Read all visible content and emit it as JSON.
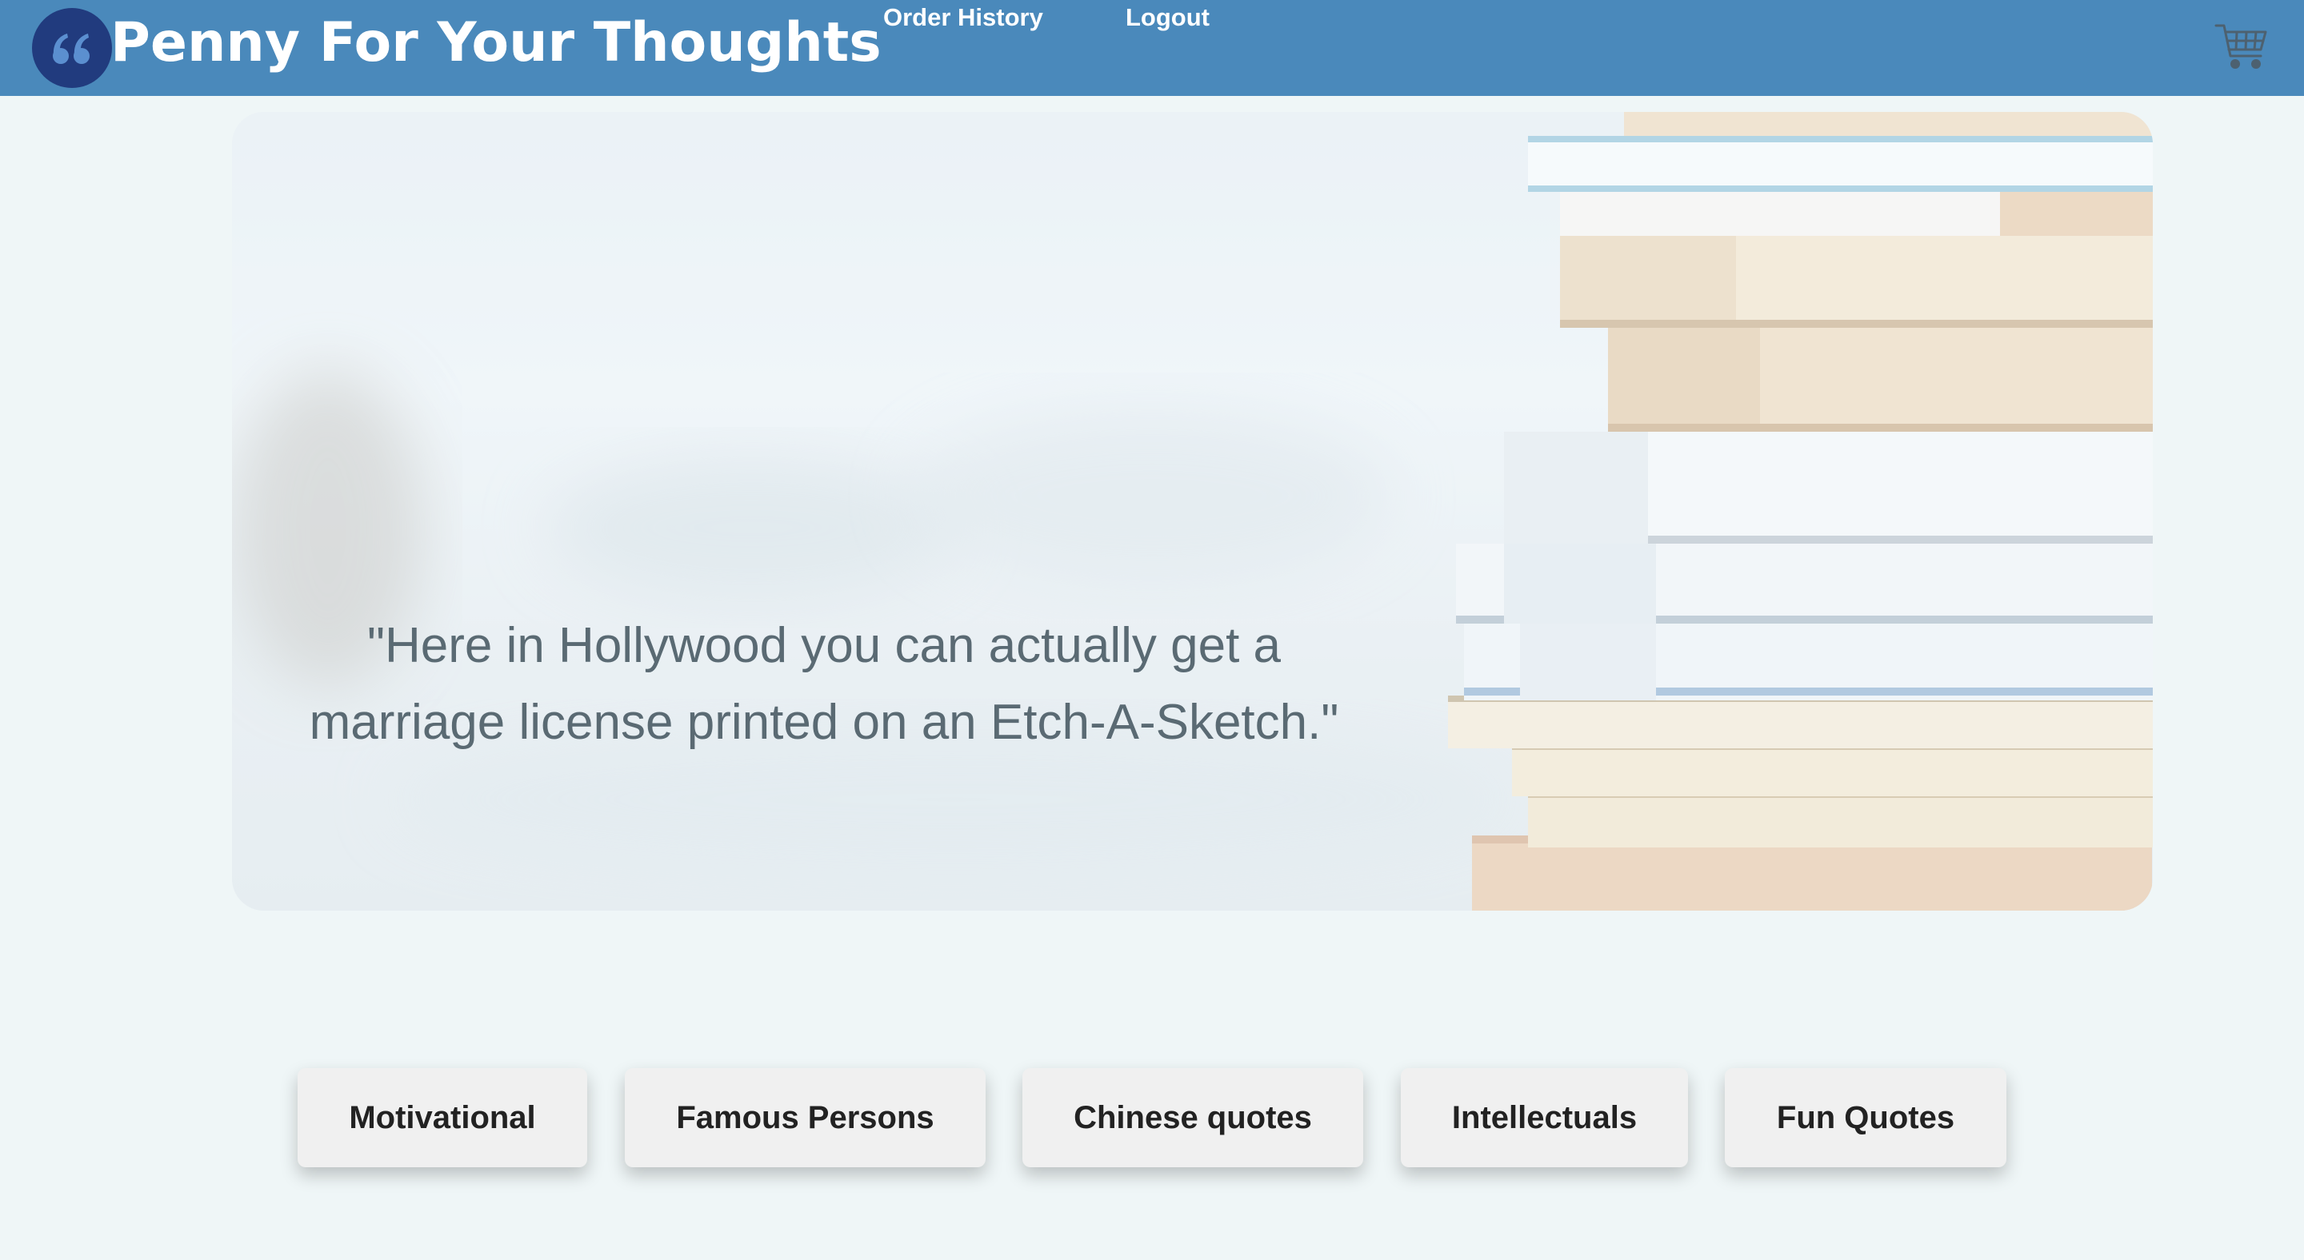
{
  "header": {
    "brand": "Penny For Your Thoughts",
    "logo_icon": "quote-mark-icon",
    "nav": {
      "order_history": "Order History",
      "logout": "Logout"
    },
    "cart_icon": "shopping-cart-icon",
    "colors": {
      "navbar": "#4a89bb",
      "logo": "#213b7e"
    }
  },
  "hero": {
    "quote": "\"Here in Hollywood you can actually get a marriage license printed on an Etch-A-Sketch.\""
  },
  "categories": [
    {
      "label": "Motivational"
    },
    {
      "label": "Famous Persons"
    },
    {
      "label": "Chinese quotes"
    },
    {
      "label": "Intellectuals"
    },
    {
      "label": "Fun Quotes"
    }
  ]
}
